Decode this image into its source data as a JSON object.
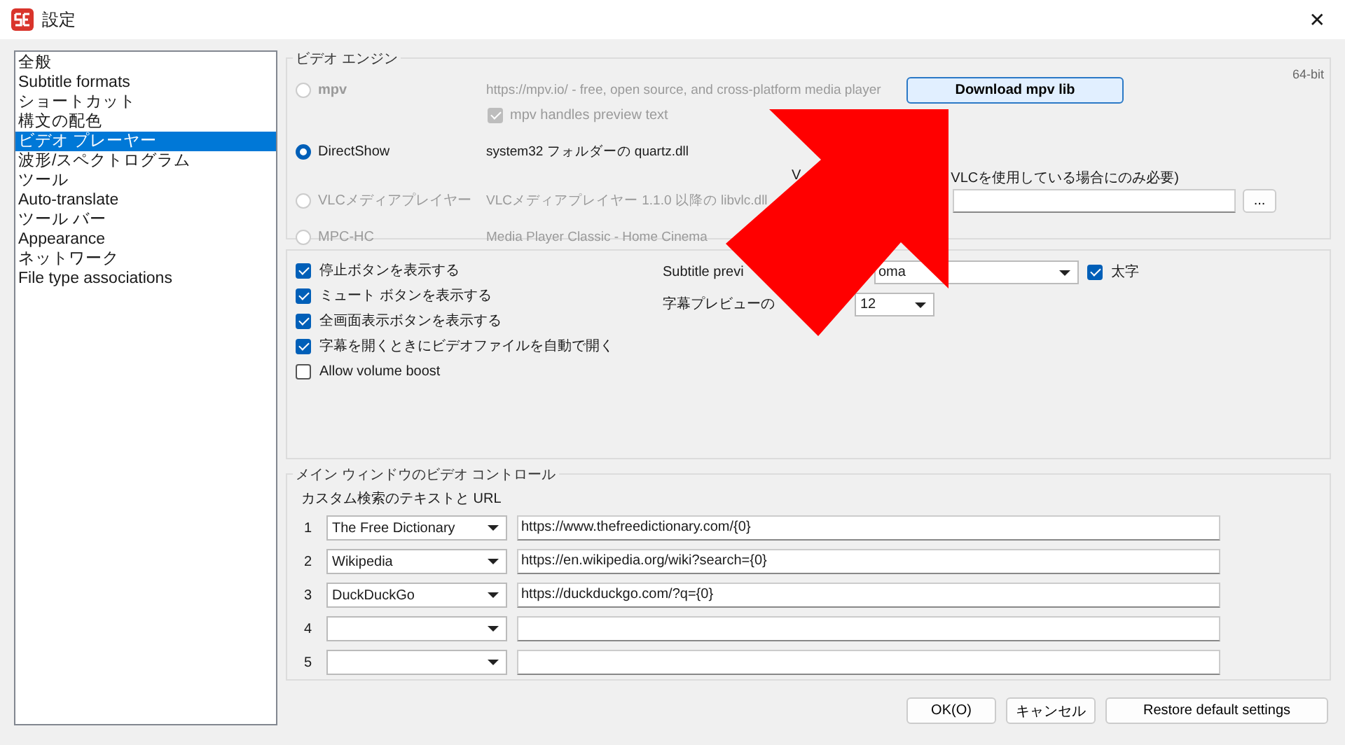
{
  "window": {
    "title": "設定",
    "close": "✕"
  },
  "sidebar": {
    "items": [
      {
        "label": "全般",
        "selected": false
      },
      {
        "label": "Subtitle formats",
        "selected": false
      },
      {
        "label": "ショートカット",
        "selected": false
      },
      {
        "label": "構文の配色",
        "selected": false
      },
      {
        "label": "ビデオ プレーヤー",
        "selected": true
      },
      {
        "label": "波形/スペクトログラム",
        "selected": false
      },
      {
        "label": "ツール",
        "selected": false
      },
      {
        "label": "Auto-translate",
        "selected": false
      },
      {
        "label": "ツール バー",
        "selected": false
      },
      {
        "label": "Appearance",
        "selected": false
      },
      {
        "label": "ネットワーク",
        "selected": false
      },
      {
        "label": "File type associations",
        "selected": false
      }
    ]
  },
  "video_engine": {
    "title": "ビデオ エンジン",
    "bitness": "64-bit",
    "engines": [
      {
        "label": "mpv",
        "description": "https://mpv.io/ - free, open source, and cross-platform media player",
        "selected": false,
        "disabled": true
      },
      {
        "label": "DirectShow",
        "description": "system32 フォルダーの quartz.dll",
        "selected": true,
        "disabled": false
      },
      {
        "label": "VLCメディアプレイヤー",
        "description": "VLCメディアプレイヤー 1.1.0 以降の libvlc.dll",
        "selected": false,
        "disabled": true
      },
      {
        "label": "MPC-HC",
        "description": "Media Player Classic - Home Cinema",
        "selected": false,
        "disabled": true
      }
    ],
    "download_button": "Download mpv lib",
    "mpv_preview": {
      "label": "mpv handles preview text",
      "checked": true,
      "disabled": true
    },
    "vlc_path": {
      "label_start": "V",
      "label_end": "VLCを使用している場合にのみ必要)",
      "browse": "..."
    }
  },
  "options": {
    "checkboxes": [
      {
        "label": "停止ボタンを表示する",
        "checked": true
      },
      {
        "label": "ミュート ボタンを表示する",
        "checked": true
      },
      {
        "label": "全画面表示ボタンを表示する",
        "checked": true
      },
      {
        "label": "字幕を開くときにビデオファイルを自動で開く",
        "checked": true
      },
      {
        "label": "Allow volume boost",
        "checked": false
      }
    ],
    "preview_font": {
      "label": "Subtitle previ",
      "value": "oma",
      "bold_label": "太字",
      "bold": true
    },
    "preview_size": {
      "label": "字幕プレビューの",
      "value": "12"
    }
  },
  "video_controls": {
    "title": "メイン ウィンドウのビデオ コントロール",
    "subtitle": "カスタム検索のテキストと URL",
    "rows": [
      {
        "number": "1",
        "name": "The Free Dictionary",
        "url": "https://www.thefreedictionary.com/{0}"
      },
      {
        "number": "2",
        "name": "Wikipedia",
        "url": "https://en.wikipedia.org/wiki?search={0}"
      },
      {
        "number": "3",
        "name": "DuckDuckGo",
        "url": "https://duckduckgo.com/?q={0}"
      },
      {
        "number": "4"
      },
      {
        "number": "5"
      }
    ]
  },
  "buttons": [
    {
      "label": "OK(O)",
      "kind": "ok"
    },
    {
      "label": "キャンセル",
      "kind": "plain"
    },
    {
      "label": "Restore default settings",
      "kind": "wide"
    }
  ]
}
